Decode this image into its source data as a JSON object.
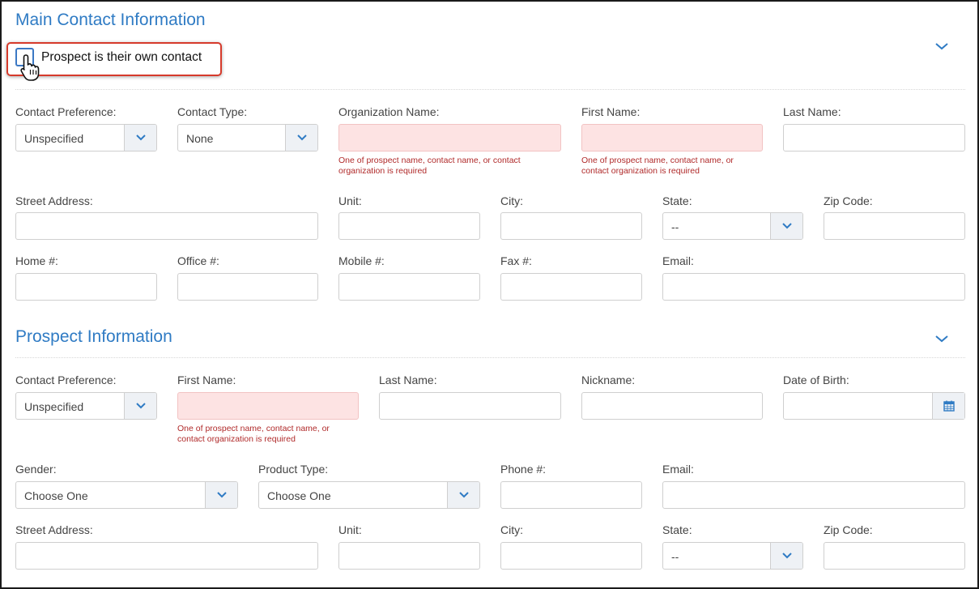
{
  "main_contact": {
    "title": "Main Contact Information",
    "own_contact_checkbox_label": "Prospect is their own contact",
    "labels": {
      "contact_preference": "Contact Preference:",
      "contact_type": "Contact Type:",
      "organization_name": "Organization Name:",
      "first_name": "First Name:",
      "last_name": "Last Name:",
      "street_address": "Street Address:",
      "unit": "Unit:",
      "city": "City:",
      "state": "State:",
      "zip_code": "Zip Code:",
      "home": "Home #:",
      "office": "Office #:",
      "mobile": "Mobile #:",
      "fax": "Fax #:",
      "email": "Email:"
    },
    "values": {
      "contact_preference": "Unspecified",
      "contact_type": "None",
      "state": "--"
    },
    "errors": {
      "organization_name": "One of prospect name, contact name, or contact organization is required",
      "first_name": "One of prospect name, contact name, or contact organization is required"
    }
  },
  "prospect": {
    "title": "Prospect Information",
    "labels": {
      "contact_preference": "Contact Preference:",
      "first_name": "First Name:",
      "last_name": "Last Name:",
      "nickname": "Nickname:",
      "date_of_birth": "Date of Birth:",
      "gender": "Gender:",
      "product_type": "Product Type:",
      "phone": "Phone #:",
      "email": "Email:",
      "street_address": "Street Address:",
      "unit": "Unit:",
      "city": "City:",
      "state": "State:",
      "zip_code": "Zip Code:"
    },
    "values": {
      "contact_preference": "Unspecified",
      "gender": "Choose One",
      "product_type": "Choose One",
      "state": "--"
    },
    "errors": {
      "first_name": "One of prospect name, contact name, or contact organization is required"
    }
  },
  "icons": {
    "chevron": "chevron-down-icon",
    "calendar": "calendar-icon",
    "cursor": "hand-pointer-icon"
  },
  "colors": {
    "accent": "#2f7bc4",
    "error_bg": "#fde3e3",
    "error_text": "#b02a2a",
    "highlight": "#d63a2b"
  }
}
